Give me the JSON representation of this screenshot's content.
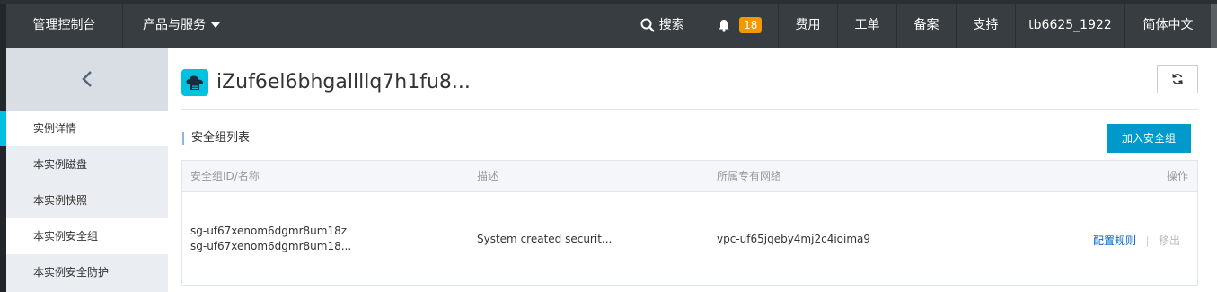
{
  "topbar": {
    "home_label": "管理控制台",
    "products_label": "产品与服务",
    "search_label": "搜索",
    "notification_count": "18",
    "fee_label": "费用",
    "ticket_label": "工单",
    "icp_label": "备案",
    "support_label": "支持",
    "user_label": "tb6625_1922",
    "lang_label": "简体中文"
  },
  "sidebar": {
    "items": [
      {
        "label": "实例详情",
        "active": true
      },
      {
        "label": "本实例磁盘",
        "active": false
      },
      {
        "label": "本实例快照",
        "active": false
      },
      {
        "label": "本实例安全组",
        "active": false
      },
      {
        "label": "本实例安全防护",
        "active": false
      }
    ]
  },
  "main": {
    "title": "iZuf6el6bhgallllq7h1fu8...",
    "section_title": "安全组列表",
    "add_button_label": "加入安全组",
    "table": {
      "headers": [
        "安全组ID/名称",
        "描述",
        "所属专有网络",
        "操作"
      ],
      "rows": [
        {
          "id": "sg-uf67xenom6dgmr8um18z",
          "name": "sg-uf67xenom6dgmr8um18...",
          "description": "System created securit...",
          "vpc": "vpc-uf65jqeby4mj2c4ioima9",
          "action_config": "配置规则",
          "action_remove": "移出"
        }
      ]
    }
  },
  "colors": {
    "topbar_bg": "#373d41",
    "accent": "#00c1de",
    "primary_button": "#0099cc",
    "badge": "#f39800",
    "link": "#0066cc"
  }
}
